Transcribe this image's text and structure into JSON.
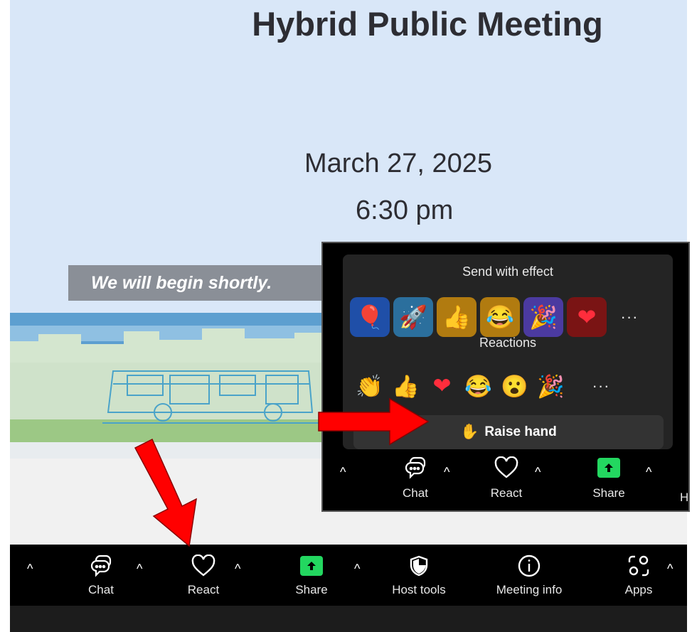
{
  "slide": {
    "title": "Hybrid Public Meeting",
    "date": "March 27, 2025",
    "time": "6:30 pm",
    "banner": "We will begin shortly."
  },
  "toolbar": {
    "items": [
      {
        "label": "Chat",
        "icon": "chat-icon"
      },
      {
        "label": "React",
        "icon": "heart-icon"
      },
      {
        "label": "Share",
        "icon": "share-icon"
      },
      {
        "label": "Host tools",
        "icon": "shield-icon"
      },
      {
        "label": "Meeting info",
        "icon": "info-icon"
      },
      {
        "label": "Apps",
        "icon": "apps-icon"
      }
    ],
    "caret": "^"
  },
  "reaction_panel": {
    "effects_heading": "Send with effect",
    "effects": [
      {
        "name": "balloon",
        "glyph": "🎈",
        "color": "#1f4fa8"
      },
      {
        "name": "rocket",
        "glyph": "🚀",
        "color": "#2b6f9d"
      },
      {
        "name": "thumbs-up",
        "glyph": "👍",
        "color": "#b17b10"
      },
      {
        "name": "laughing",
        "glyph": "😂",
        "color": "#b17b10"
      },
      {
        "name": "party",
        "glyph": "🎉",
        "color": "#4b3aa0"
      },
      {
        "name": "heart",
        "glyph": "❤",
        "color": "#7a1414"
      }
    ],
    "reactions_heading": "Reactions",
    "reactions": [
      {
        "name": "clap",
        "glyph": "👏"
      },
      {
        "name": "thumbs-up",
        "glyph": "👍"
      },
      {
        "name": "heart",
        "glyph": "❤"
      },
      {
        "name": "laughing",
        "glyph": "😂"
      },
      {
        "name": "surprised",
        "glyph": "😮"
      },
      {
        "name": "party",
        "glyph": "🎉"
      }
    ],
    "more_glyph": "···",
    "raise_hand_label": "Raise hand",
    "raise_hand_glyph": "✋"
  },
  "inset_toolbar": {
    "items": [
      {
        "label": "Chat"
      },
      {
        "label": "React"
      },
      {
        "label": "Share"
      }
    ],
    "partial_label": "H"
  },
  "colors": {
    "toolbar_bg": "#000000",
    "share_green": "#23d760",
    "panel_bg": "#242424",
    "arrow_red": "#ff0000"
  }
}
